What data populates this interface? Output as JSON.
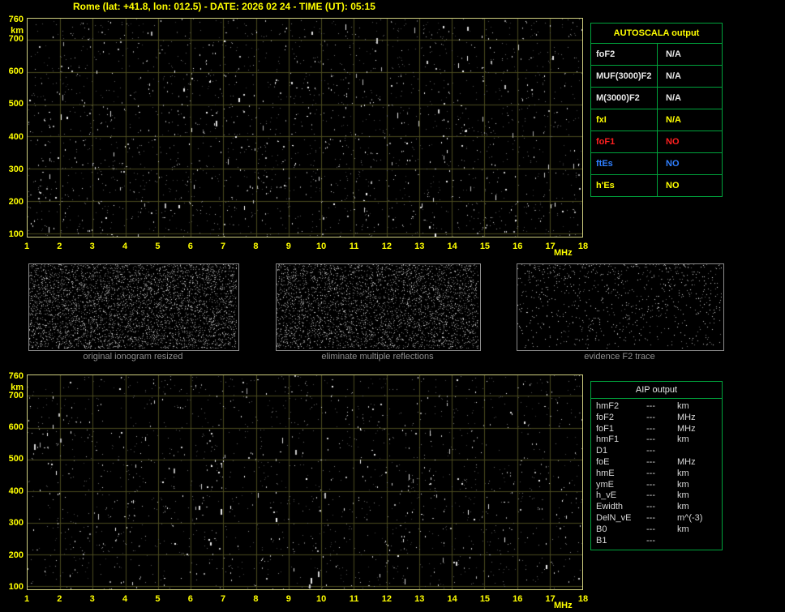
{
  "header": {
    "title": "Rome (lat: +41.8, lon: 012.5) - DATE: 2026 02 24 - TIME (UT): 05:15"
  },
  "colors": {
    "title": "#ffff00",
    "plot_border": "#cfcf7f",
    "grid": "#4a4a1e",
    "table_border": "#00a33c",
    "caption": "#8f8f8f",
    "white": "#e8e8e8",
    "yellow": "#ffff00",
    "red": "#ff2020",
    "blue": "#2f7fff"
  },
  "ionogram_top": {
    "y_unit": "km",
    "y_ticks": [
      "760",
      "700",
      "600",
      "500",
      "400",
      "300",
      "200",
      "100"
    ],
    "x_ticks": [
      "1",
      "2",
      "3",
      "4",
      "5",
      "6",
      "7",
      "8",
      "9",
      "10",
      "11",
      "12",
      "13",
      "14",
      "15",
      "16",
      "17",
      "18"
    ],
    "x_unit": "MHz"
  },
  "ionogram_bottom": {
    "y_unit": "km",
    "y_ticks": [
      "760",
      "700",
      "600",
      "500",
      "400",
      "300",
      "200",
      "100"
    ],
    "x_ticks": [
      "1",
      "2",
      "3",
      "4",
      "5",
      "6",
      "7",
      "8",
      "9",
      "10",
      "11",
      "12",
      "13",
      "14",
      "15",
      "16",
      "17",
      "18"
    ],
    "x_unit": "MHz"
  },
  "autoscala_table": {
    "title": "AUTOSCALA output",
    "rows": [
      {
        "label": "foF2",
        "value": "N/A",
        "color": "white"
      },
      {
        "label": "MUF(3000)F2",
        "value": "N/A",
        "color": "white"
      },
      {
        "label": "M(3000)F2",
        "value": "N/A",
        "color": "white"
      },
      {
        "label": "fxI",
        "value": "N/A",
        "color": "yellow"
      },
      {
        "label": "foF1",
        "value": "NO",
        "color": "red"
      },
      {
        "label": "ftEs",
        "value": "NO",
        "color": "blue"
      },
      {
        "label": "h'Es",
        "value": "NO",
        "color": "yellow"
      }
    ]
  },
  "thumbnails": [
    {
      "caption": "original ionogram resized"
    },
    {
      "caption": "eliminate multiple reflections"
    },
    {
      "caption": "evidence F2 trace"
    }
  ],
  "aip_table": {
    "title": "AIP output",
    "rows": [
      {
        "name": "hmF2",
        "value": "---",
        "unit": "km"
      },
      {
        "name": "foF2",
        "value": "---",
        "unit": "MHz"
      },
      {
        "name": "foF1",
        "value": "---",
        "unit": "MHz"
      },
      {
        "name": "hmF1",
        "value": "---",
        "unit": "km"
      },
      {
        "name": "D1",
        "value": "---",
        "unit": ""
      },
      {
        "name": "foE",
        "value": "---",
        "unit": "MHz"
      },
      {
        "name": "hmE",
        "value": "---",
        "unit": "km"
      },
      {
        "name": "ymE",
        "value": "---",
        "unit": "km"
      },
      {
        "name": "h_vE",
        "value": "---",
        "unit": "km"
      },
      {
        "name": "Ewidth",
        "value": "---",
        "unit": "km"
      },
      {
        "name": "DelN_vE",
        "value": "---",
        "unit": "m^(-3)"
      },
      {
        "name": "B0",
        "value": "---",
        "unit": "km"
      },
      {
        "name": "B1",
        "value": "---",
        "unit": ""
      }
    ]
  }
}
